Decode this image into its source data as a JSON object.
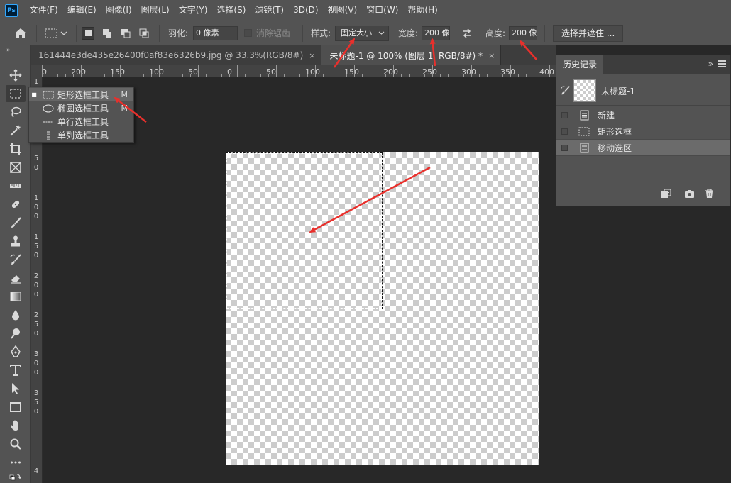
{
  "app": {
    "logo": "Ps"
  },
  "menu": [
    "文件(F)",
    "编辑(E)",
    "图像(I)",
    "图层(L)",
    "文字(Y)",
    "选择(S)",
    "滤镜(T)",
    "3D(D)",
    "视图(V)",
    "窗口(W)",
    "帮助(H)"
  ],
  "options": {
    "feather_label": "羽化:",
    "feather_value": "0 像素",
    "antialias_label": "消除锯齿",
    "style_label": "样式:",
    "style_value": "固定大小",
    "width_label": "宽度:",
    "width_value": "200 像素",
    "height_label": "高度:",
    "height_value": "200 像素",
    "select_mask_label": "选择并遮住 ..."
  },
  "tabs": [
    {
      "label": "161444e3de435e26400f0af83e6326b9.jpg @ 33.3%(RGB/8#)",
      "close": "×",
      "active": false
    },
    {
      "label": "未标题-1 @ 100% (图层 1, RGB/8#) *",
      "close": "×",
      "active": true
    }
  ],
  "ruler_top": [
    "0",
    "200",
    "150",
    "100",
    "50",
    "0",
    "50",
    "100",
    "150",
    "200",
    "250",
    "300",
    "350",
    "400"
  ],
  "ruler_left": [
    "1",
    "0",
    "5",
    "0",
    "1",
    "0",
    "0",
    "1",
    "5",
    "0",
    "2",
    "0",
    "0",
    "2",
    "5",
    "0",
    "3",
    "0",
    "0",
    "3",
    "5",
    "0",
    "4"
  ],
  "flyout": {
    "items": [
      {
        "label": "矩形选框工具",
        "key": "M",
        "active": true
      },
      {
        "label": "椭圆选框工具",
        "key": "M",
        "active": false
      },
      {
        "label": "单行选框工具",
        "key": "",
        "active": false
      },
      {
        "label": "单列选框工具",
        "key": "",
        "active": false
      }
    ]
  },
  "history": {
    "title": "历史记录",
    "collapse": "»",
    "snapshot_label": "未标题-1",
    "rows": [
      {
        "label": "新建",
        "icon": "document-icon",
        "active": false
      },
      {
        "label": "矩形选框",
        "icon": "marquee-icon",
        "active": false
      },
      {
        "label": "移动选区",
        "icon": "document-icon",
        "active": true
      }
    ]
  },
  "colors": {
    "accent": "#31a8ff",
    "annotation": "#e8302c",
    "panel": "#535353",
    "workspace": "#282828"
  }
}
